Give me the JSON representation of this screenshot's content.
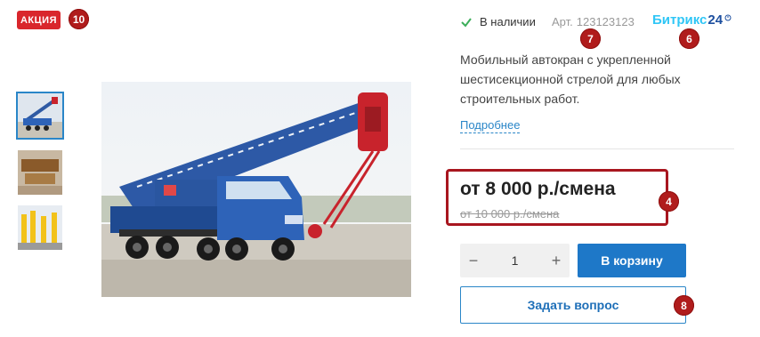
{
  "badge": {
    "label": "АКЦИЯ"
  },
  "markers": {
    "m10": "10",
    "m7": "7",
    "m6": "6",
    "m4": "4",
    "m8": "8"
  },
  "product": {
    "stock_label": "В наличии",
    "sku_label": "Арт.",
    "sku_value": "123123123",
    "brand_logo_text": "Битрикс",
    "brand_logo_number": "24",
    "description": "Мобильный автокран с укрепленной шестисекционной стрелой для любых строительных работ.",
    "more_link": "Подробнее"
  },
  "price": {
    "current": "от 8 000 р./смена",
    "old": "от 10 000 р./смена"
  },
  "quantity": {
    "minus": "−",
    "value": "1",
    "plus": "+"
  },
  "buttons": {
    "cart": "В корзину",
    "ask": "Задать вопрос"
  },
  "icons": {
    "stock": "check-icon",
    "logo_suffix": "clock-icon"
  },
  "colors": {
    "badge": "#d9262c",
    "marker": "#b01c1c",
    "primary": "#1e78c8",
    "stock_check": "#3cae5a",
    "logo": "#2fc6f6"
  }
}
